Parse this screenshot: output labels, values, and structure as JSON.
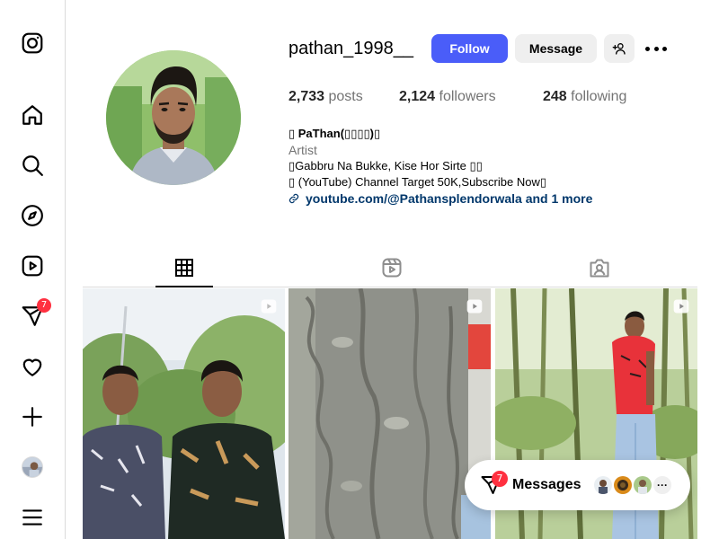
{
  "sidebar": {
    "items": [
      {
        "name": "instagram-logo",
        "icon": "instagram-icon"
      },
      {
        "name": "home",
        "icon": "home-icon"
      },
      {
        "name": "search",
        "icon": "search-icon"
      },
      {
        "name": "explore",
        "icon": "compass-icon"
      },
      {
        "name": "reels",
        "icon": "reels-icon"
      },
      {
        "name": "messages",
        "icon": "paper-plane-icon",
        "badge": "7"
      },
      {
        "name": "notifications",
        "icon": "heart-icon"
      },
      {
        "name": "create",
        "icon": "plus-icon"
      },
      {
        "name": "profile",
        "icon": "avatar"
      },
      {
        "name": "more",
        "icon": "menu-icon"
      }
    ]
  },
  "profile": {
    "username": "pathan_1998__",
    "follow_label": "Follow",
    "message_label": "Message",
    "stats": {
      "posts_count": "2,733",
      "posts_label": " posts",
      "followers_count": "2,124",
      "followers_label": " followers",
      "following_count": "248",
      "following_label": " following"
    },
    "bio": {
      "name": "▯ PaThan(▯▯▯▯)▯",
      "category": "Artist",
      "line1": "▯Gabbru Na Bukke, Kise Hor Sirte ▯▯",
      "line2": "▯ (YouTube) Channel Target 50K,Subscribe Now▯",
      "link_text": "youtube.com/@Pathansplendorwala and 1 more"
    }
  },
  "tabs": [
    {
      "name": "posts",
      "icon": "grid-icon",
      "active": true
    },
    {
      "name": "reels",
      "icon": "reels-icon",
      "active": false
    },
    {
      "name": "tagged",
      "icon": "tagged-icon",
      "active": false
    }
  ],
  "messages_pill": {
    "label": "Messages",
    "badge": "7",
    "more": "···"
  },
  "colors": {
    "primary_button": "#4a5df9",
    "secondary_button": "#efefef",
    "link": "#00376b",
    "badge": "#ff3040",
    "muted_text": "#737373"
  }
}
